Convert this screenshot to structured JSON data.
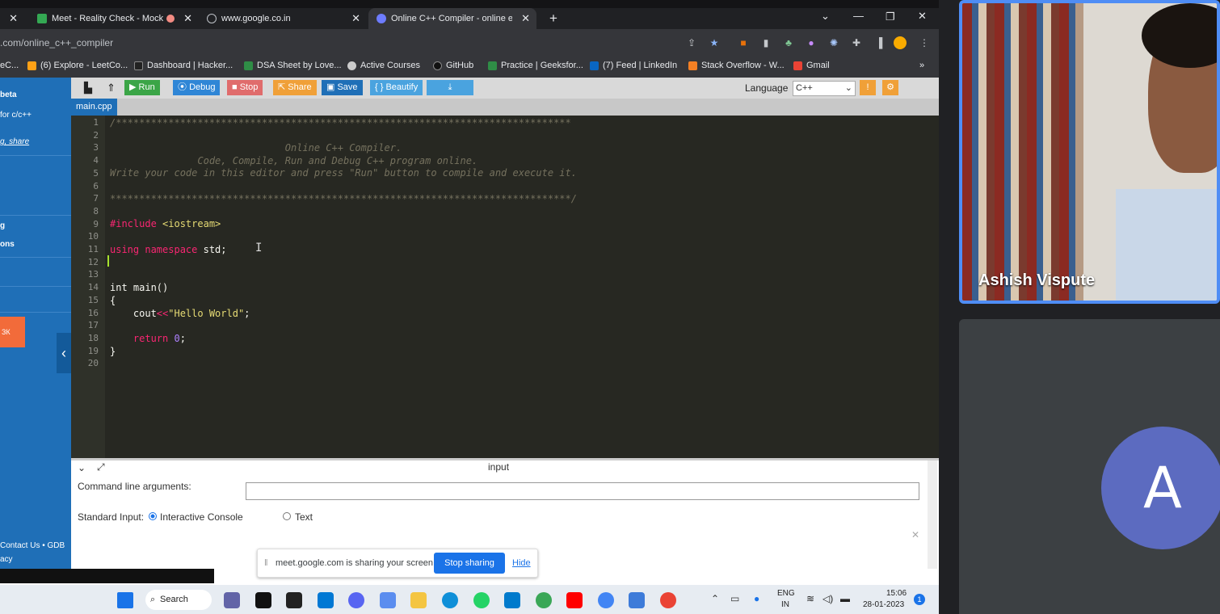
{
  "tabs": [
    {
      "label": "",
      "partial": true
    },
    {
      "label": "Meet - Reality Check - Mock"
    },
    {
      "label": "www.google.co.in"
    },
    {
      "label": "Online C++ Compiler - online ec"
    }
  ],
  "new_tab_symbol": "+",
  "address": {
    "url": ".com/online_c++_compiler"
  },
  "bookmarks": [
    "eC...",
    "(6) Explore - LeetCo...",
    "Dashboard | Hacker...",
    "DSA Sheet by Love...",
    "Active Courses",
    "GitHub",
    "Practice | Geeksfor...",
    "(7) Feed | LinkedIn",
    "Stack Overflow - W...",
    "Gmail"
  ],
  "bookmarks_more": "»",
  "sidebar": {
    "items": [
      "beta",
      "for c/c++",
      "g, share",
      "g",
      "ons"
    ],
    "orange_label": "ЗК",
    "footer": [
      "Contact Us • GDB",
      "acy"
    ]
  },
  "toolbar": {
    "run": "Run",
    "debug": "Debug",
    "stop": "Stop",
    "share": "Share",
    "save": "Save",
    "beautify": "{ } Beautify",
    "language_label": "Language",
    "language_value": "C++"
  },
  "file_tab": "main.cpp",
  "code": {
    "line_numbers": [
      "1",
      "2",
      "3",
      "4",
      "5",
      "6",
      "7",
      "8",
      "9",
      "10",
      "11",
      "12",
      "13",
      "14",
      "15",
      "16",
      "17",
      "18",
      "19",
      "20"
    ],
    "l1": "/******************************************************************************",
    "l3": "                              Online C++ Compiler.",
    "l4": "               Code, Compile, Run and Debug C++ program online.",
    "l5": "Write your code in this editor and press \"Run\" button to compile and execute it.",
    "l7": "*******************************************************************************/",
    "l9_a": "#include ",
    "l9_b": "<iostream>",
    "l11_a": "using namespace",
    "l11_b": " std;",
    "l14": "int main()",
    "l15": "{",
    "l16_a": "    cout",
    "l16_b": "<<",
    "l16_c": "\"Hello World\"",
    "l16_d": ";",
    "l18_a": "    return ",
    "l18_b": "0",
    "l18_c": ";",
    "l19": "}"
  },
  "input_panel": {
    "title": "input",
    "cmd_label": "Command line arguments:",
    "stdin_label": "Standard Input:",
    "option_interactive": "Interactive Console",
    "option_text": "Text"
  },
  "share_notice": {
    "text": "meet.google.com is sharing your screen.",
    "stop": "Stop sharing",
    "hide": "Hide"
  },
  "taskbar": {
    "search": "Search",
    "lang_top": "ENG",
    "lang_bottom": "IN",
    "time": "15:06",
    "date": "28-01-2023",
    "badge": "1"
  },
  "participants": {
    "video_name": "Ashish Vispute",
    "avatar_letter": "A"
  },
  "colors": {
    "sidebar": "#1f6fb7",
    "run": "#3ba547",
    "debug": "#2f86d6",
    "stop": "#e06c6c",
    "share": "#f0a038",
    "save": "#1f6fb7",
    "beautify": "#4aa3df",
    "meet_border": "#4f8df5",
    "avatar": "#5c6bc0"
  }
}
